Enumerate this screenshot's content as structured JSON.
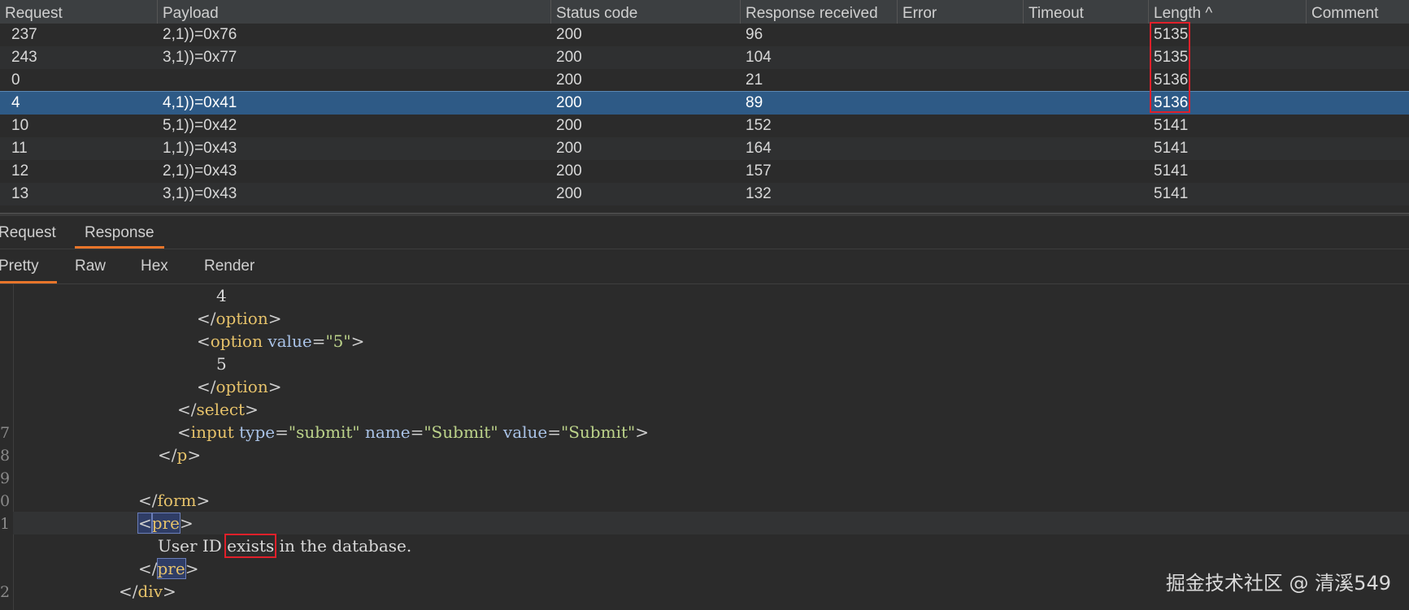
{
  "table": {
    "columns": [
      "Request",
      "Payload",
      "Status code",
      "Response received",
      "Error",
      "Timeout",
      "Length",
      "Comment"
    ],
    "sort_indicator": "^",
    "rows": [
      {
        "request": "237",
        "payload": "2,1))=0x76",
        "status": "200",
        "received": "96",
        "error": "",
        "timeout": "",
        "length": "5135",
        "comment": ""
      },
      {
        "request": "243",
        "payload": "3,1))=0x77",
        "status": "200",
        "received": "104",
        "error": "",
        "timeout": "",
        "length": "5135",
        "comment": ""
      },
      {
        "request": "0",
        "payload": "",
        "status": "200",
        "received": "21",
        "error": "",
        "timeout": "",
        "length": "5136",
        "comment": ""
      },
      {
        "request": "4",
        "payload": "4,1))=0x41",
        "status": "200",
        "received": "89",
        "error": "",
        "timeout": "",
        "length": "5136",
        "comment": ""
      },
      {
        "request": "10",
        "payload": "5,1))=0x42",
        "status": "200",
        "received": "152",
        "error": "",
        "timeout": "",
        "length": "5141",
        "comment": ""
      },
      {
        "request": "11",
        "payload": "1,1))=0x43",
        "status": "200",
        "received": "164",
        "error": "",
        "timeout": "",
        "length": "5141",
        "comment": ""
      },
      {
        "request": "12",
        "payload": "2,1))=0x43",
        "status": "200",
        "received": "157",
        "error": "",
        "timeout": "",
        "length": "5141",
        "comment": ""
      },
      {
        "request": "13",
        "payload": "3,1))=0x43",
        "status": "200",
        "received": "132",
        "error": "",
        "timeout": "",
        "length": "5141",
        "comment": ""
      }
    ]
  },
  "tabs": {
    "request_label": "Request",
    "response_label": "Response",
    "view_tabs": [
      "Pretty",
      "Raw",
      "Hex",
      "Render"
    ]
  },
  "editor": {
    "gutter": [
      "7",
      "8",
      "9",
      "0",
      "1",
      "2"
    ],
    "opt4_text": "4",
    "option_tag": "option",
    "value_attr": "value",
    "eq": "=",
    "val5": "\"5\"",
    "opt5_text": "5",
    "select_tag": "select",
    "input_tag": "input",
    "type_attr": "type",
    "submit_val": "\"submit\"",
    "name_attr": "name",
    "Submit_val": "\"Submit\"",
    "p_tag": "p",
    "form_tag": "form",
    "pre_tag": "pre",
    "text_before": "User ID ",
    "text_exists": "exists",
    "text_after": " in the database.",
    "div_tag": "div"
  },
  "watermark": "掘金技术社区 @ 清溪549",
  "colors": {
    "selected_row": "#2e5a86",
    "accent": "#e8752a",
    "highlight_box": "#e0202a"
  }
}
